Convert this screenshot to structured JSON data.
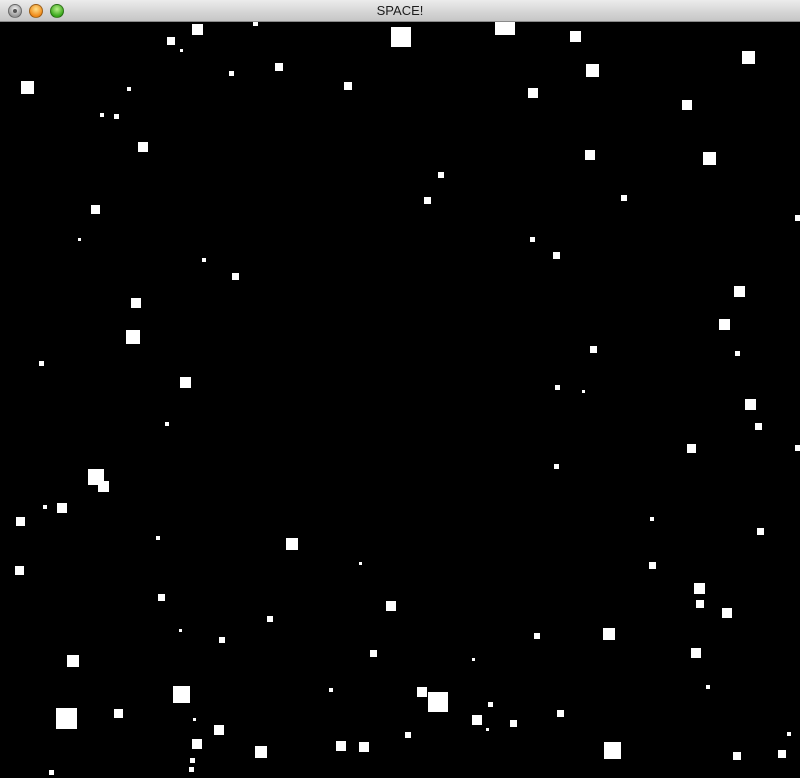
{
  "window": {
    "title": "SPACE!"
  },
  "colors": {
    "background": "#000000",
    "star": "#ffffff"
  }
}
